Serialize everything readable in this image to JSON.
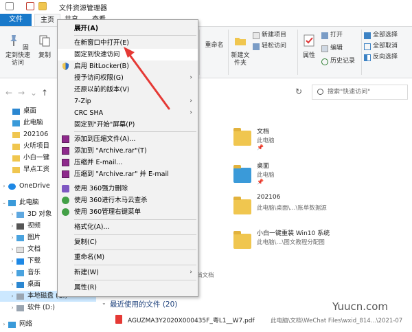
{
  "window": {
    "title": "文件资源管理器"
  },
  "tabs": {
    "file": "文件",
    "home": "主页",
    "share": "共享",
    "view": "查看"
  },
  "ribbon": {
    "pin_quick": "固定到快速访问",
    "copy": "复制",
    "rename": "重命名",
    "new_folder": "新建文件夹",
    "new_item": "新建项目",
    "easy_access": "轻松访问",
    "properties": "属性",
    "open": "打开",
    "edit": "编辑",
    "history": "历史记录",
    "select_all": "全部选择",
    "select_none": "全部取消",
    "invert": "反向选择"
  },
  "address": {
    "search_placeholder": "搜索\"快速访问\""
  },
  "nav": {
    "items": [
      "桌面",
      "此电脑",
      "202106",
      "火听项目",
      "小白一键",
      "早点工资",
      "OneDrive",
      "此电脑",
      "3D 对象",
      "视频",
      "图片",
      "文档",
      "下载",
      "音乐",
      "桌面",
      "本地磁盘 (C:)",
      "软件 (D:)",
      "网络"
    ]
  },
  "content": {
    "folders": [
      {
        "name": "文档",
        "sub": "此电脑"
      },
      {
        "name": "桌面",
        "sub": "此电脑"
      },
      {
        "name": "202106",
        "sub": "此电脑\\桌面\\...\\账单数据源"
      },
      {
        "name": "小白一键重装 Win10 系统",
        "sub": "此电脑\\...\\图文教程分配图"
      }
    ],
    "partial_label": "档文档",
    "recent_header": "最近使用的文件 (20)",
    "recent_file": "AGUZMA3Y2020X000435F_粤L1__W7.pdf",
    "recent_path": "此电脑\\文档\\WeChat Files\\wxid_814...\\2021-07"
  },
  "menu": {
    "items": [
      "展开(A)",
      "在新窗口中打开(E)",
      "固定到快速访问",
      "启用 BitLocker(B)",
      "授予访问权限(G)",
      "还原以前的版本(V)",
      "7-Zip",
      "CRC SHA",
      "固定到\"开始\"屏幕(P)",
      "添加到压缩文件(A)...",
      "添加到 \"Archive.rar\"(T)",
      "压缩并 E-mail...",
      "压缩到 \"Archive.rar\" 并 E-mail",
      "使用 360强力删除",
      "使用 360进行木马云查杀",
      "使用 360管理右键菜单",
      "格式化(A)...",
      "复制(C)",
      "重命名(M)",
      "新建(W)",
      "属性(R)"
    ],
    "submenu_glyph": "›"
  },
  "watermark": "Yuucn.com",
  "colors": {
    "accent": "#1979ca",
    "highlight": "#cce8ff",
    "arrow": "#e53935"
  }
}
